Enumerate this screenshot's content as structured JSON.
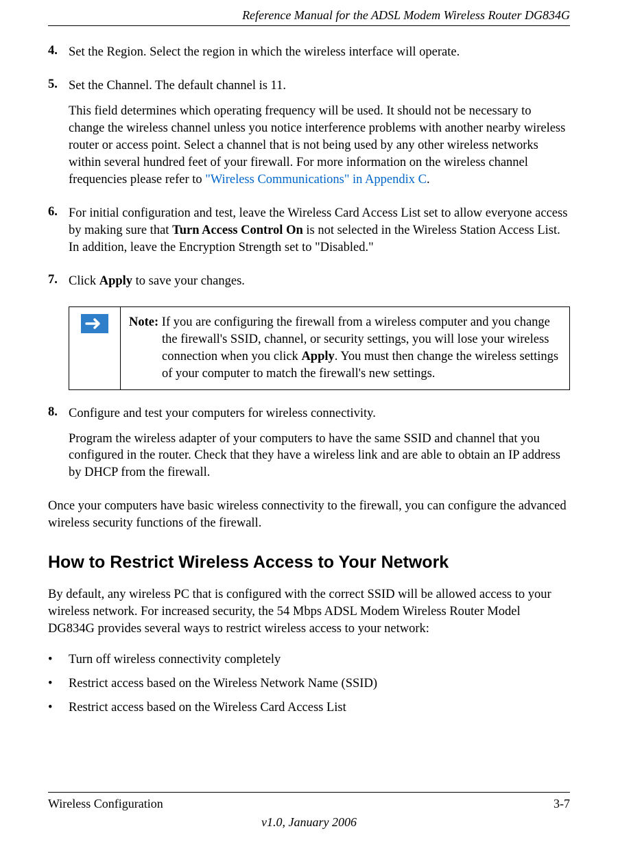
{
  "header": {
    "title": "Reference Manual for the ADSL Modem Wireless Router DG834G"
  },
  "steps": {
    "s4": {
      "num": "4.",
      "text": "Set the Region. Select the region in which the wireless interface will operate."
    },
    "s5": {
      "num": "5.",
      "p1": "Set the Channel. The default channel is 11.",
      "p2a": "This field determines which operating frequency will be used. It should not be necessary to change the wireless channel unless you notice interference problems with another nearby wireless router or access point. Select a channel that is not being used by any other wireless networks within several hundred feet of your firewall. For more information on the wireless channel frequencies please refer to ",
      "p2link": "\"Wireless Communications\" in Appendix C",
      "p2b": "."
    },
    "s6": {
      "num": "6.",
      "t1": "For initial configuration and test, leave the Wireless Card Access List set to allow everyone access by making sure that ",
      "bold1": "Turn Access Control On",
      "t2": " is not selected in the Wireless Station Access List. In addition, leave the Encryption Strength set to \"Disabled.\""
    },
    "s7": {
      "num": "7.",
      "t1": "Click ",
      "bold1": "Apply",
      "t2": " to save your changes."
    },
    "s8": {
      "num": "8.",
      "p1": "Configure and test your computers for wireless connectivity.",
      "p2": "Program the wireless adapter of your computers to have the same SSID and channel that you configured in the router. Check that they have a wireless link and are able to obtain an IP address by DHCP from the firewall."
    }
  },
  "note": {
    "label": "Note:",
    "t1": " If you are configuring the firewall from a wireless computer and you change the firewall's SSID, channel, or security settings, you will lose your wireless connection when you click ",
    "bold": "Apply",
    "t2": ". You must then change the wireless settings of your computer to match the firewall's new settings."
  },
  "closing": "Once your computers have basic wireless connectivity to the firewall, you can configure the advanced wireless security functions of the firewall.",
  "section": {
    "heading": "How to Restrict Wireless Access to Your Network",
    "intro": "By default, any wireless PC that is configured with the correct SSID will be allowed access to your wireless network. For increased security, the 54 Mbps ADSL Modem Wireless Router Model DG834G provides several ways to restrict wireless access to your network:",
    "bullets": [
      "Turn off wireless connectivity completely",
      "Restrict access based on the Wireless Network Name (SSID)",
      "Restrict access based on the Wireless Card Access List"
    ]
  },
  "footer": {
    "left": "Wireless Configuration",
    "right": "3-7",
    "center": "v1.0, January 2006"
  }
}
